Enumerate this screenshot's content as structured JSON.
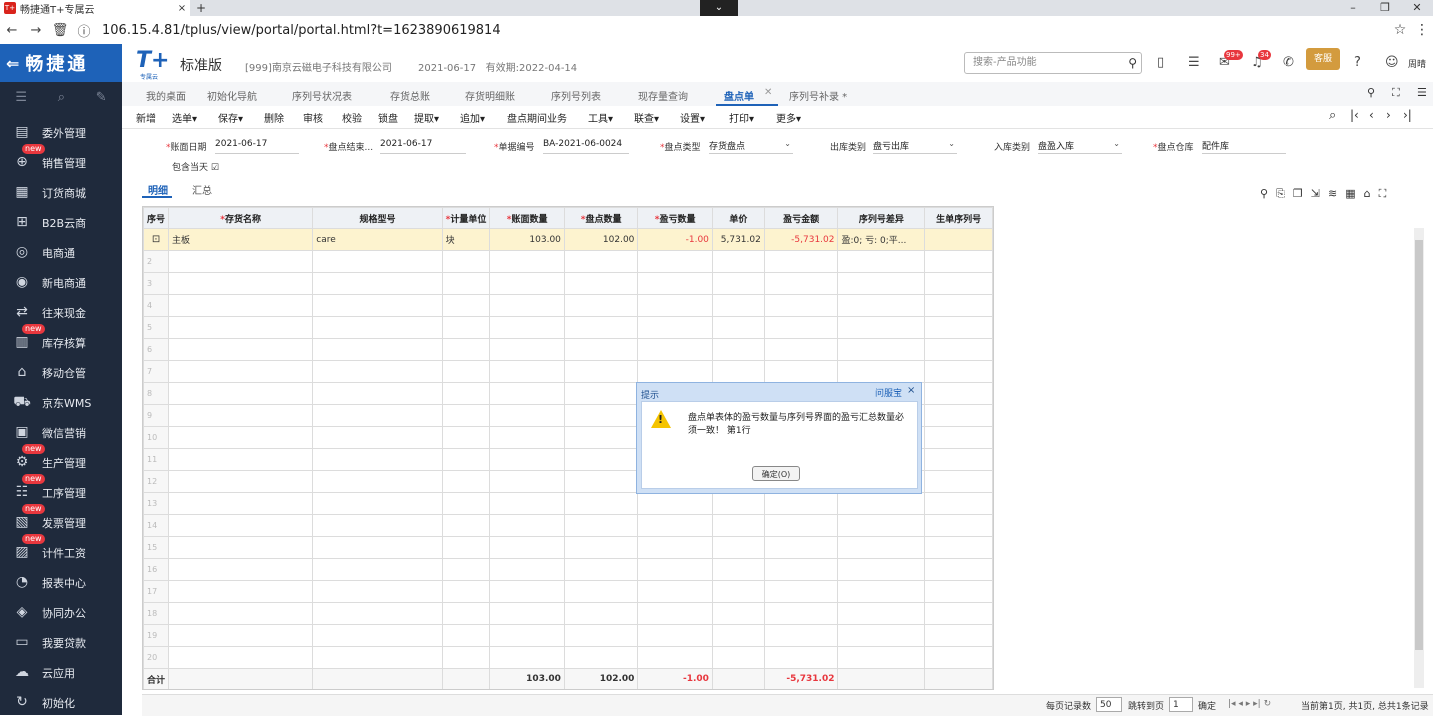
{
  "browser": {
    "tab_title": "畅捷通T+专属云",
    "tab_favicon": "T+",
    "tab_close": "×",
    "new_tab": "+",
    "url": "106.15.4.81/tplus/view/portal/portal.html?t=1623890619814"
  },
  "brand": {
    "name": "畅捷通",
    "back": "⇐"
  },
  "header": {
    "logo": "T+",
    "logo_sub": "专属云",
    "edition": "标准版",
    "company": "[999]南京云磁电子科技有限公司",
    "date": "2021-06-17",
    "validity": "有效期:2022-04-14",
    "search_placeholder": "搜索-产品功能",
    "badge_msg": "99+",
    "badge_notice": "34",
    "helper": "客服",
    "user": "周晴"
  },
  "sidebar": [
    {
      "label": "委外管理",
      "icon": "clipboard-icon",
      "new": ""
    },
    {
      "label": "销售管理",
      "icon": "sales-icon",
      "new": "new"
    },
    {
      "label": "订货商城",
      "icon": "store-icon",
      "new": ""
    },
    {
      "label": "B2B云商",
      "icon": "b2b-icon",
      "new": ""
    },
    {
      "label": "电商通",
      "icon": "ecommerce-icon",
      "new": ""
    },
    {
      "label": "新电商通",
      "icon": "new-ecommerce-icon",
      "new": ""
    },
    {
      "label": "往来现金",
      "icon": "cash-icon",
      "new": ""
    },
    {
      "label": "库存核算",
      "icon": "inventory-icon",
      "new": "new"
    },
    {
      "label": "移动仓管",
      "icon": "mobile-warehouse-icon",
      "new": ""
    },
    {
      "label": "京东WMS",
      "icon": "truck-icon",
      "new": ""
    },
    {
      "label": "微信营销",
      "icon": "wechat-icon",
      "new": ""
    },
    {
      "label": "生产管理",
      "icon": "production-icon",
      "new": "new"
    },
    {
      "label": "工序管理",
      "icon": "process-icon",
      "new": "new"
    },
    {
      "label": "发票管理",
      "icon": "invoice-icon",
      "new": "new"
    },
    {
      "label": "计件工资",
      "icon": "wage-icon",
      "new": "new"
    },
    {
      "label": "报表中心",
      "icon": "report-icon",
      "new": ""
    },
    {
      "label": "协同办公",
      "icon": "collab-icon",
      "new": ""
    },
    {
      "label": "我要贷款",
      "icon": "loan-icon",
      "new": ""
    },
    {
      "label": "云应用",
      "icon": "cloud-icon",
      "new": ""
    },
    {
      "label": "初始化",
      "icon": "init-icon",
      "new": ""
    }
  ],
  "page_tabs": [
    {
      "label": "我的桌面"
    },
    {
      "label": "初始化导航"
    },
    {
      "label": "序列号状况表"
    },
    {
      "label": "存货总账"
    },
    {
      "label": "存货明细账"
    },
    {
      "label": "序列号列表"
    },
    {
      "label": "现存量查询"
    },
    {
      "label": "盘点单"
    },
    {
      "label": "序列号补录 *"
    }
  ],
  "toolbar": [
    "新增",
    "选单▾",
    "保存▾",
    "删除",
    "审核",
    "校验",
    "锁盘",
    "提取▾",
    "追加▾",
    "盘点期间业务",
    "工具▾",
    "联查▾",
    "设置▾",
    "打印▾",
    "更多▾"
  ],
  "form": {
    "book_date_label": "账面日期",
    "book_date": "2021-06-17",
    "end_date_label": "盘点结束...",
    "end_date": "2021-06-17",
    "doc_no_label": "单据编号",
    "doc_no": "BA-2021-06-0024",
    "count_type_label": "盘点类型",
    "count_type": "存货盘点",
    "out_type_label": "出库类别",
    "out_type": "盘亏出库",
    "in_type_label": "入库类别",
    "in_type": "盘盈入库",
    "warehouse_label": "盘点仓库",
    "warehouse": "配件库",
    "include_today": "包含当天 ☑"
  },
  "subtabs": {
    "detail": "明细",
    "summary": "汇总"
  },
  "table": {
    "headers": [
      "序号",
      "存货名称",
      "规格型号",
      "计量单位",
      "账面数量",
      "盘点数量",
      "盈亏数量",
      "单价",
      "盈亏金额",
      "序列号差异",
      "生单序列号"
    ],
    "row1": [
      "主板",
      "care",
      "块",
      "103.00",
      "102.00",
      "-1.00",
      "5,731.02",
      "-5,731.02",
      "盈:0; 亏: 0;平..."
    ],
    "row_numbers": [
      "2",
      "3",
      "4",
      "5",
      "6",
      "7",
      "8",
      "9",
      "10",
      "11",
      "12",
      "13",
      "14",
      "15",
      "16",
      "17",
      "18",
      "19",
      "20"
    ],
    "total_label": "合计",
    "total": [
      "103.00",
      "102.00",
      "-1.00",
      "-5,731.02"
    ]
  },
  "pager": {
    "per_page_label": "每页记录数",
    "per_page": "50",
    "jump_label": "跳转到页",
    "jump": "1",
    "confirm": "确定",
    "info": "当前第1页, 共1页, 总共1条记录"
  },
  "dialog": {
    "title": "提示",
    "help": "问服宝",
    "close": "×",
    "message": "盘点单表体的盈亏数量与序列号界面的盈亏汇总数量必须一致！ 第1行",
    "ok": "确定(O)"
  }
}
